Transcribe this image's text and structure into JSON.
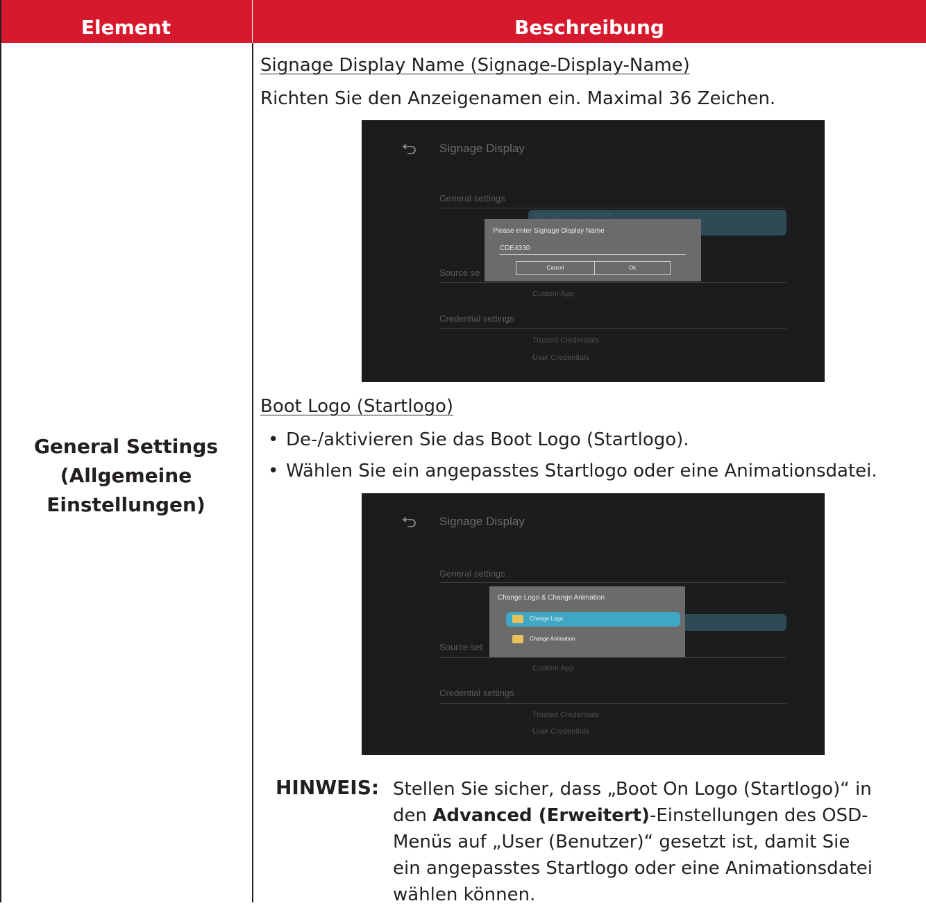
{
  "table": {
    "header": {
      "element": "Element",
      "description": "Beschreibung"
    },
    "row": {
      "element_lines": [
        "General Settings",
        "(Allgemeine",
        "Einstellungen)"
      ]
    }
  },
  "section1": {
    "heading": "Signage Display Name (Signage-Display-Name)",
    "text": "Richten Sie den Anzeigenamen ein. Maximal 36 Zeichen."
  },
  "screenshot1": {
    "title": "Signage Display",
    "general_settings": "General settings",
    "hidden_item": "Signage Display Name",
    "source_settings_partial": "Source se",
    "custom_app": "Custom App",
    "credential_settings": "Credential settings",
    "trusted_credentials": "Trusted Credentials",
    "user_credentials": "User Credentials",
    "dialog": {
      "title": "Please enter Signage Display Name",
      "input_value": "CDE4330",
      "cancel": "Cancel",
      "ok": "Ok"
    }
  },
  "section2": {
    "heading": "Boot Logo (Startlogo)",
    "bullets": [
      "De-/aktivieren Sie das Boot Logo (Startlogo).",
      "Wählen Sie ein angepasstes Startlogo oder eine Animationsdatei."
    ]
  },
  "screenshot2": {
    "title": "Signage Display",
    "general_settings": "General settings",
    "source_settings_partial": "Source set",
    "custom_app": "Custom App",
    "credential_settings": "Credential settings",
    "trusted_credentials": "Trusted Credentials",
    "user_credentials": "User Credentials",
    "dialog": {
      "title": "Change Logo & Change Animation",
      "options": [
        "Change Logo",
        "Change Animation"
      ]
    }
  },
  "note": {
    "label": "HINWEIS:",
    "line1": "Stellen Sie sicher, dass „Boot On Logo (Startlogo)“ in",
    "line2_pre": "den ",
    "line2_bold": "Advanced (Erweitert)",
    "line2_post": "-Einstellungen des OSD-",
    "line3": "Menüs auf „User (Benutzer)“ gesetzt ist, damit Sie",
    "line4": "ein angepasstes Startlogo oder eine Animationsdatei",
    "line5": "wählen können."
  },
  "colors": {
    "header_bg": "#d7192e",
    "highlight": "#3fa7c4"
  }
}
